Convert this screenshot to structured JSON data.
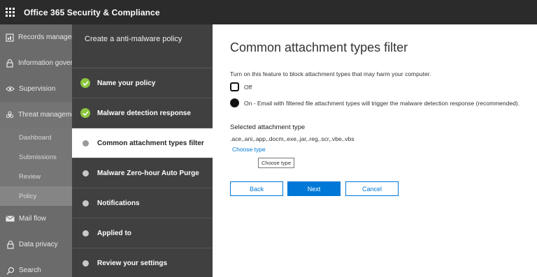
{
  "app": {
    "title": "Office 365 Security & Compliance"
  },
  "leftnav": {
    "items": [
      {
        "label": "Records management",
        "icon": "records-icon"
      },
      {
        "label": "Information governance",
        "icon": "lock-icon"
      },
      {
        "label": "Supervision",
        "icon": "eye-icon"
      },
      {
        "label": "Threat management",
        "icon": "biohazard-icon"
      }
    ],
    "sub_items": [
      {
        "label": "Dashboard"
      },
      {
        "label": "Submissions"
      },
      {
        "label": "Review"
      },
      {
        "label": "Policy"
      }
    ],
    "items_after": [
      {
        "label": "Mail flow",
        "icon": "mail-icon"
      },
      {
        "label": "Data privacy",
        "icon": "lock-icon"
      },
      {
        "label": "Search",
        "icon": "search-icon"
      }
    ]
  },
  "wizard": {
    "title": "Create a anti-malware policy",
    "steps": [
      {
        "label": "Name your policy",
        "state": "done"
      },
      {
        "label": "Malware detection response",
        "state": "done"
      },
      {
        "label": "Common attachment types filter",
        "state": "current"
      },
      {
        "label": "Malware Zero-hour Auto Purge",
        "state": "pending"
      },
      {
        "label": "Notifications",
        "state": "pending"
      },
      {
        "label": "Applied to",
        "state": "pending"
      },
      {
        "label": "Review your settings",
        "state": "pending"
      }
    ]
  },
  "main": {
    "heading": "Common attachment types filter",
    "description": "Turn on this feature to block attachment types that may harm your computer.",
    "option_off": "Off",
    "option_on": "On - Email with filtered file attachment types will trigger the malware detection response (recommended).",
    "selected_label": "Selected attachment type",
    "selected_value": ".ace,.ani,.app,.docm,.exe,.jar,.reg,.scr,.vbe,.vbs",
    "choose_link": "Choose type",
    "tooltip": "Choose type",
    "buttons": {
      "back": "Back",
      "next": "Next",
      "cancel": "Cancel"
    }
  },
  "colors": {
    "accent": "#0078d7",
    "check": "#8cc63f",
    "topbar": "#2b2b2b"
  }
}
